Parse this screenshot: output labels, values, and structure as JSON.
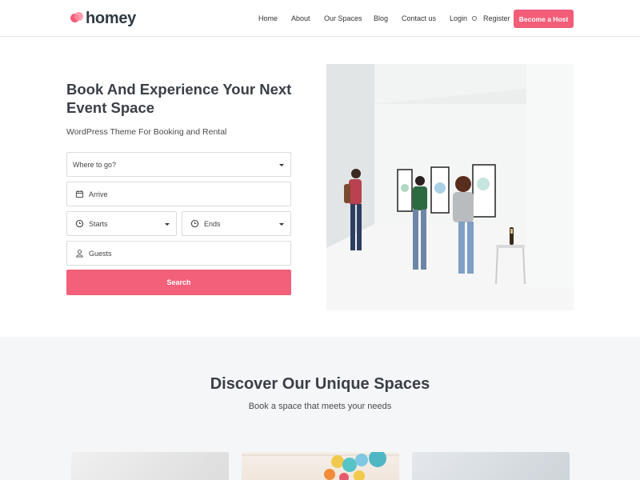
{
  "header": {
    "logo_text": "homey",
    "nav": {
      "home": "Home",
      "about": "About",
      "our_spaces": "Our Spaces",
      "blog": "Blog",
      "contact": "Contact us",
      "login": "Login",
      "register": "Register"
    },
    "cta": "Become a Host"
  },
  "hero": {
    "title": "Book And Experience Your Next Event Space",
    "subtitle": "WordPress Theme For Booking and Rental",
    "search_form": {
      "where_placeholder": "Where to go?",
      "arrive_placeholder": "Arrive",
      "starts_placeholder": "Starts",
      "ends_placeholder": "Ends",
      "guests_placeholder": "Guests",
      "search_label": "Search"
    }
  },
  "discover": {
    "title": "Discover Our Unique Spaces",
    "subtitle": "Book a space that meets your needs"
  },
  "colors": {
    "accent": "#f25d78",
    "heading": "#3a3f47",
    "section_bg": "#f4f6f8"
  },
  "icons": [
    "heart-logo-icon",
    "user-circle-icon",
    "calendar-icon",
    "clock-icon",
    "person-icon",
    "caret-down-icon"
  ]
}
